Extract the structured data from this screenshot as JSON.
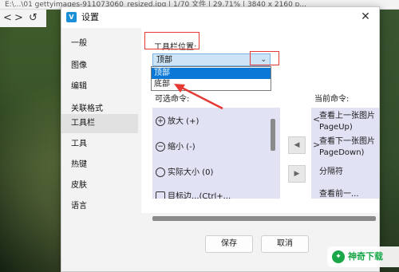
{
  "viewer": {
    "title": "E:\\...\\01 gettyimages-911073060_resized.jpg  |  1/70 文件  |  29.71%  |  3840 x 2160 p...",
    "nav_prev": "<",
    "nav_next": ">",
    "rotate": "↺"
  },
  "dialog": {
    "icon_letter": "V",
    "title": "设置",
    "close": "✕"
  },
  "sidebar": {
    "items": [
      {
        "label": "一般"
      },
      {
        "label": "图像"
      },
      {
        "label": "编辑"
      },
      {
        "label": "关联格式"
      },
      {
        "label": "工具栏",
        "active": true
      },
      {
        "label": "工具"
      },
      {
        "label": "热键"
      },
      {
        "label": "皮肤"
      },
      {
        "label": "语言"
      }
    ]
  },
  "toolbar_position": {
    "label": "工具栏位置:",
    "selected": "顶部",
    "options": [
      "顶部",
      "底部"
    ]
  },
  "available": {
    "label": "可选命令:",
    "items": [
      {
        "icon": "+",
        "text": "放大 (+)"
      },
      {
        "icon": "−",
        "text": "缩小 (-)"
      },
      {
        "icon": "",
        "text": "实际大小 (0)"
      },
      {
        "icon": "",
        "text": "目标边...(Ctrl+..."
      }
    ]
  },
  "current": {
    "label": "当前命令:",
    "items": [
      {
        "chevron": "<",
        "text": "查看上一张图片",
        "sub": "PageUp)"
      },
      {
        "chevron": ">",
        "text": "查看下一张图片",
        "sub": "PageDown)"
      },
      {
        "chevron": "",
        "text": "分隔符",
        "sub": ""
      },
      {
        "chevron": "",
        "text": "查看前一...",
        "sub": ""
      }
    ]
  },
  "move_buttons": {
    "left": "◀",
    "right": "▶"
  },
  "buttons": {
    "save": "保存",
    "cancel": "取消"
  },
  "watermark": {
    "logo": "✦",
    "text": "神奇下载"
  },
  "colors": {
    "accent": "#0a78d7",
    "annotation": "#e53935",
    "list_bg": "#e1e2f4"
  }
}
